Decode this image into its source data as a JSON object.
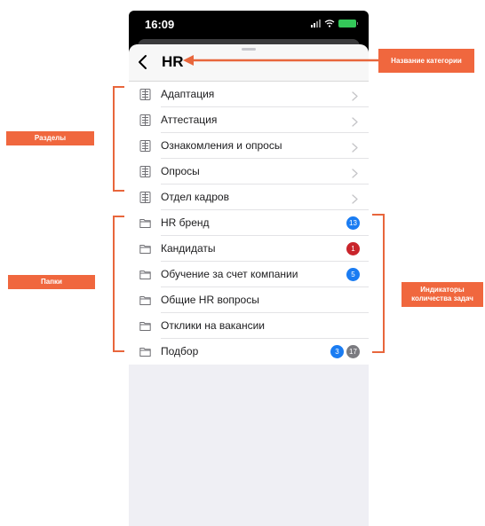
{
  "status": {
    "time": "16:09"
  },
  "nav": {
    "title": "HR"
  },
  "sections": [
    {
      "label": "Адаптация"
    },
    {
      "label": "Аттестация"
    },
    {
      "label": "Ознакомления и опросы"
    },
    {
      "label": "Опросы"
    },
    {
      "label": "Отдел кадров"
    }
  ],
  "folders": [
    {
      "label": "HR бренд",
      "badges": [
        {
          "value": "13",
          "color": "#1a7cf2"
        }
      ]
    },
    {
      "label": "Кандидаты",
      "badges": [
        {
          "value": "1",
          "color": "#c9242b"
        }
      ]
    },
    {
      "label": "Обучение за счет компании",
      "badges": [
        {
          "value": "5",
          "color": "#1a7cf2"
        }
      ]
    },
    {
      "label": "Общие HR вопросы",
      "badges": []
    },
    {
      "label": "Отклики на вакансии",
      "badges": []
    },
    {
      "label": "Подбор",
      "badges": [
        {
          "value": "3",
          "color": "#1a7cf2"
        },
        {
          "value": "17",
          "color": "#7b7b80"
        }
      ]
    }
  ],
  "annotations": {
    "category_name": "Название категории",
    "sections": "Разделы",
    "folders": "Папки",
    "indicators": "Индикаторы количества задач"
  },
  "colors": {
    "accent": "#f0673e",
    "badge_blue": "#1a7cf2",
    "badge_red": "#c9242b",
    "badge_gray": "#7b7b80"
  },
  "icons": {
    "section": "list-icon",
    "folder": "folder-icon",
    "row": "chevron-right-icon",
    "back": "chevron-left-icon"
  }
}
